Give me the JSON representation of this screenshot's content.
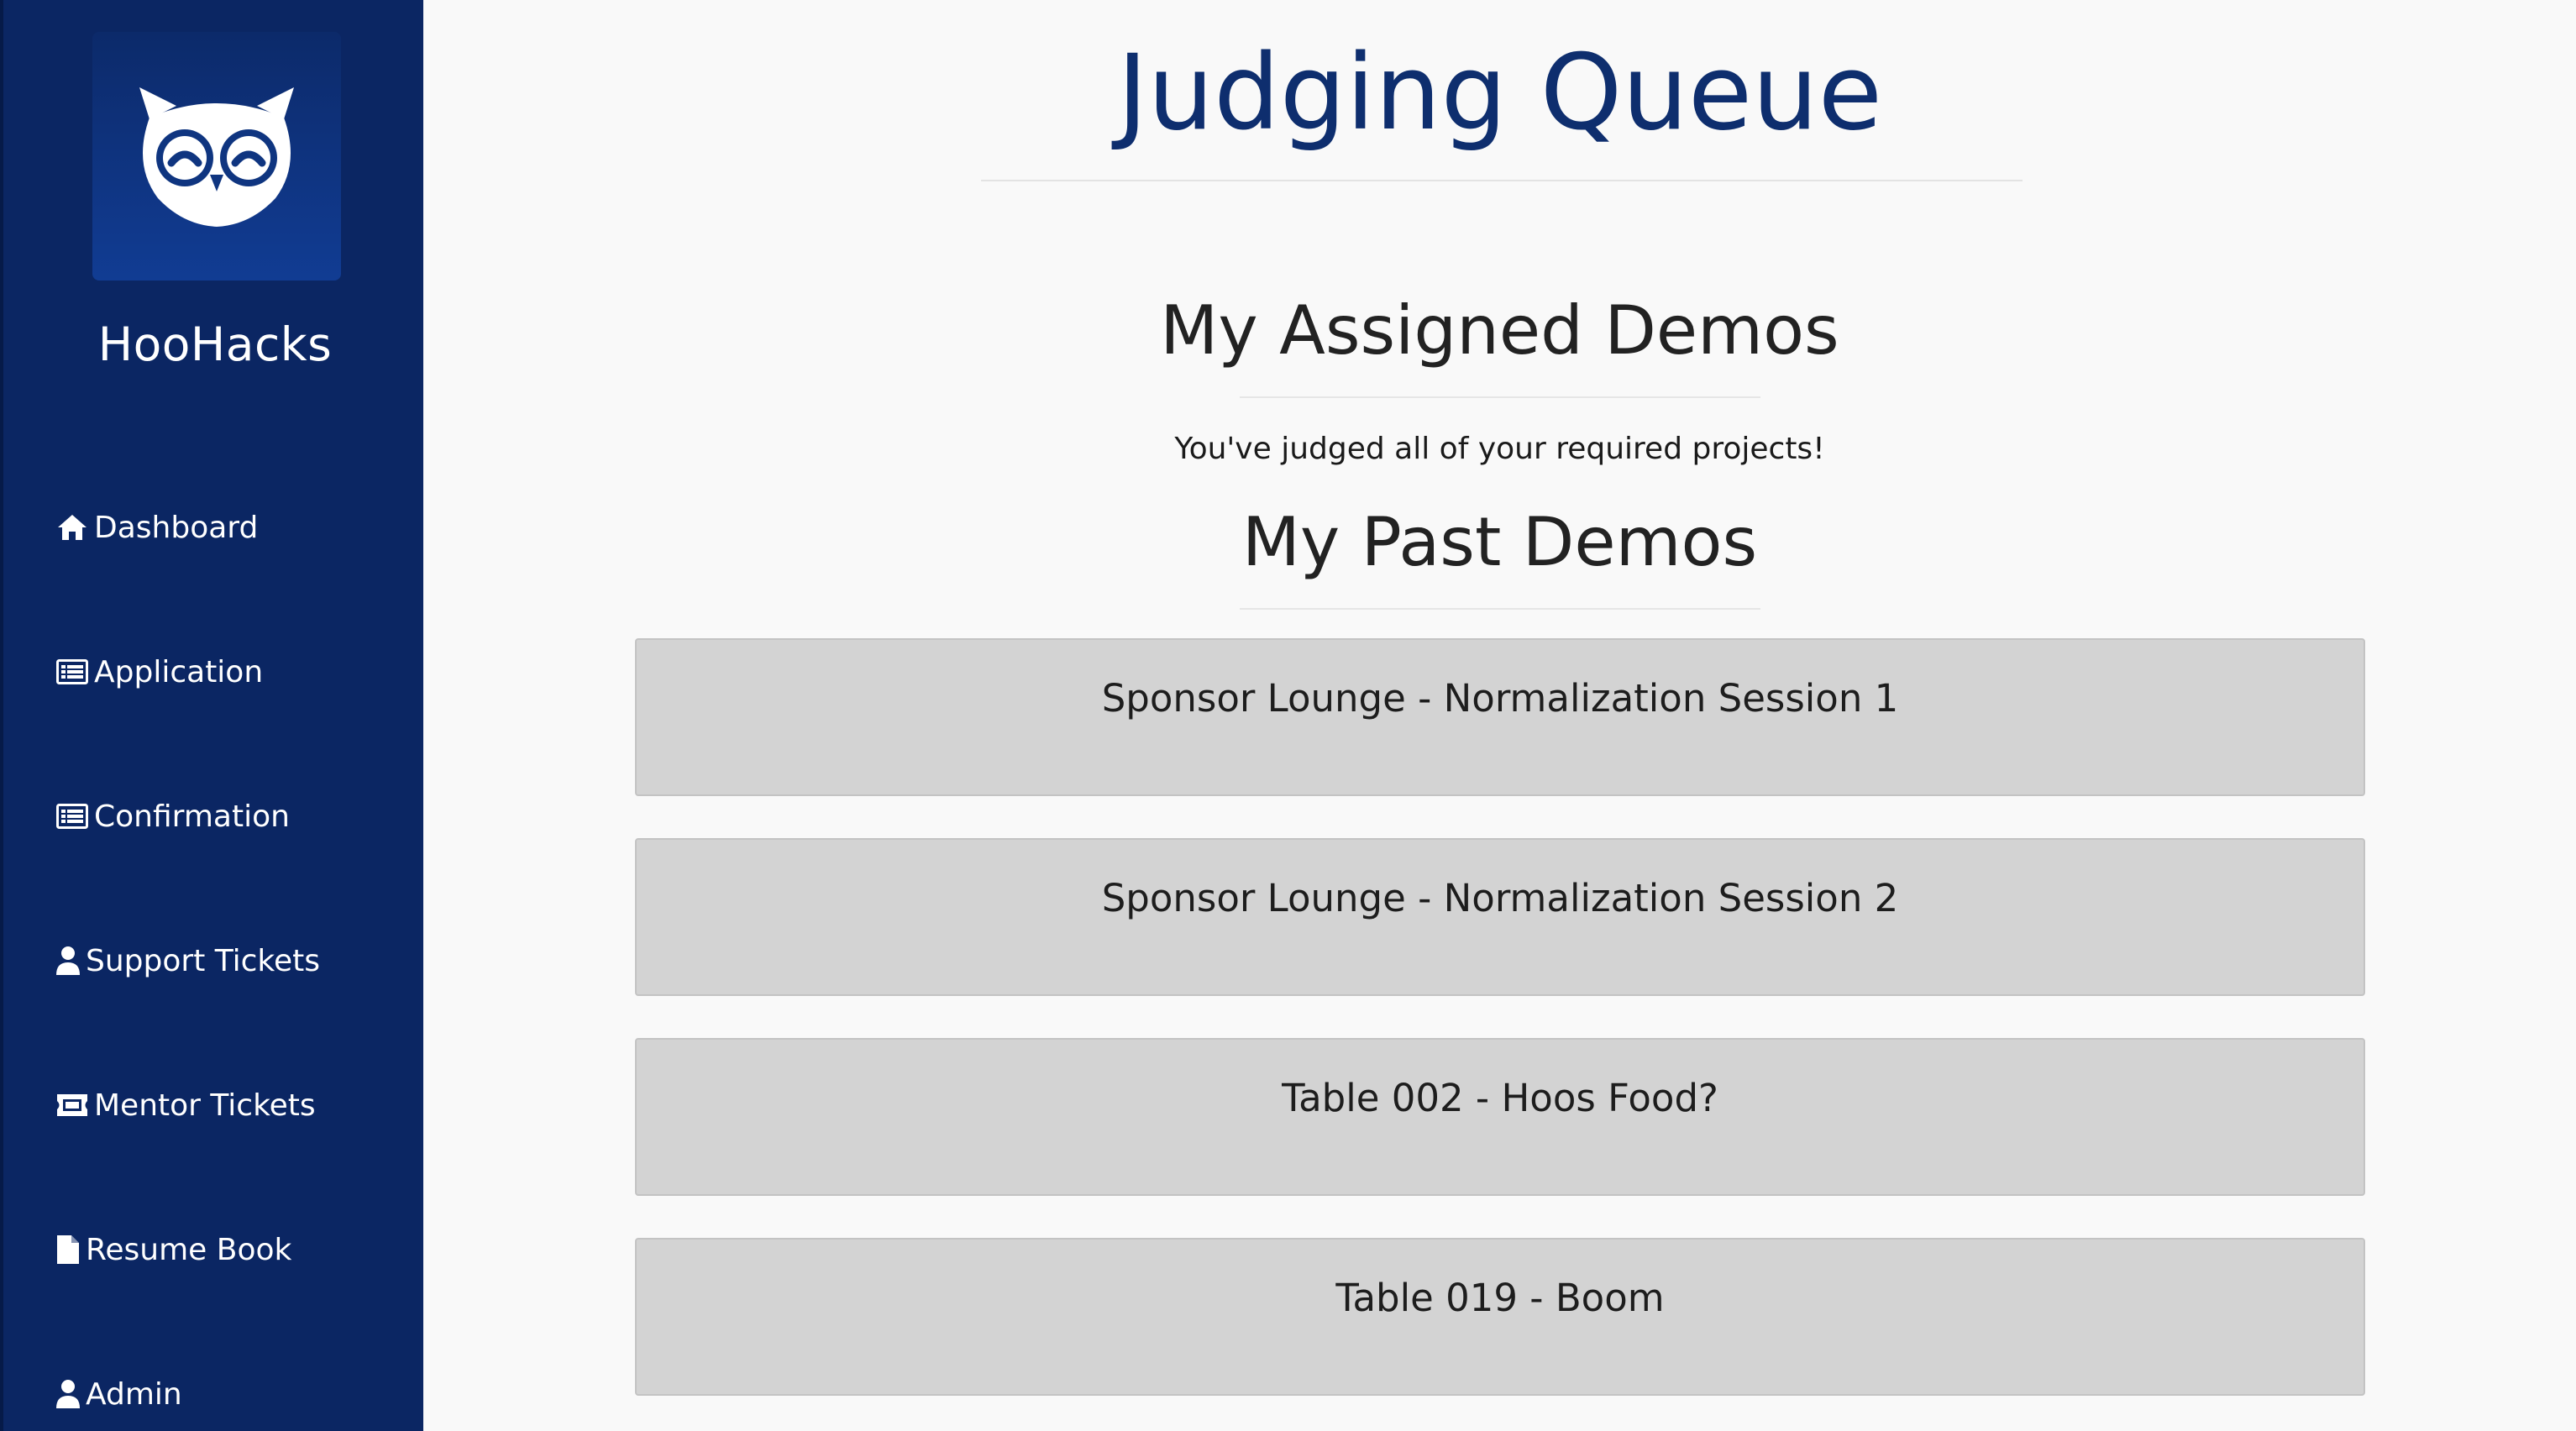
{
  "sidebar": {
    "brand": "HooHacks",
    "items": [
      {
        "label": "Dashboard",
        "icon": "home-icon"
      },
      {
        "label": "Application",
        "icon": "list-icon"
      },
      {
        "label": "Confirmation",
        "icon": "list-icon"
      },
      {
        "label": "Support Tickets",
        "icon": "user-icon"
      },
      {
        "label": "Mentor Tickets",
        "icon": "ticket-icon"
      },
      {
        "label": "Resume Book",
        "icon": "file-icon"
      },
      {
        "label": "Admin",
        "icon": "user-icon"
      }
    ]
  },
  "main": {
    "title": "Judging Queue",
    "assigned_heading": "My Assigned Demos",
    "assigned_note": "You've judged all of your required projects!",
    "past_heading": "My Past Demos",
    "past_demos": [
      "Sponsor Lounge - Normalization Session 1",
      "Sponsor Lounge - Normalization Session 2",
      "Table 002 - Hoos Food?",
      "Table 019 - Boom"
    ]
  },
  "colors": {
    "sidebar_bg": "#0b2663",
    "title_color": "#0e2e6e",
    "card_bg": "#d3d3d3",
    "page_bg": "#f9f9f9"
  }
}
